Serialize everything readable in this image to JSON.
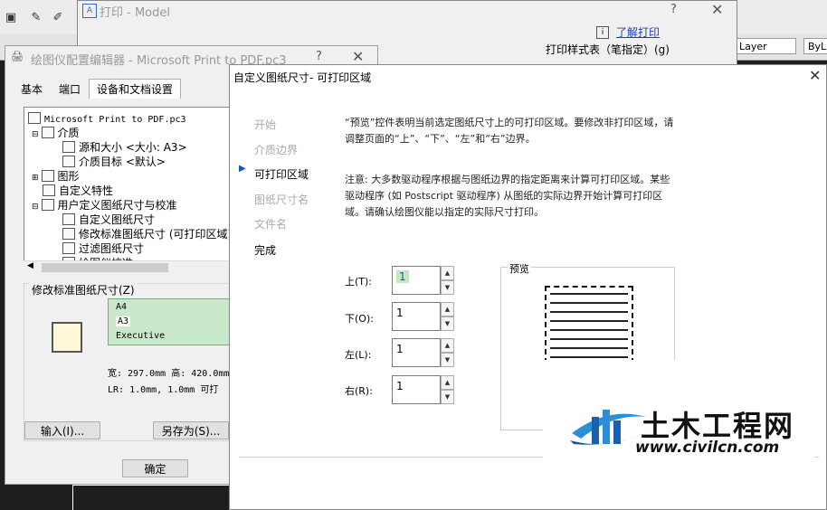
{
  "print_dialog": {
    "title": "打印 - Model",
    "help": "?",
    "learn_link": "了解打印",
    "plot_style_label": "打印样式表（笔指定）(g)"
  },
  "cad": {
    "layer_combo": "Layer",
    "bylayer_combo": "ByL"
  },
  "pc3_dialog": {
    "title": "绘图仪配置编辑器 - Microsoft Print to PDF.pc3",
    "help": "?",
    "tabs": [
      "基本",
      "端口",
      "设备和文档设置"
    ],
    "tree": [
      "Microsoft Print to PDF.pc3",
      "介质",
      "源和大小 <大小: A3>",
      "介质目标 <默认>",
      "图形",
      "自定义特性",
      "用户定义图纸尺寸与校准",
      "自定义图纸尺寸",
      "修改标准图纸尺寸 (可打印区域)",
      "过滤图纸尺寸",
      "绘图仪校准"
    ],
    "modify_group_label": "修改标准图纸尺寸(Z)",
    "papers": [
      "A4",
      "A3",
      "Executive"
    ],
    "size_info": "宽: 297.0mm 高: 420.0mm",
    "margin_info": "LR: 1.0mm, 1.0mm  可打",
    "import_btn": "输入(I)...",
    "saveas_btn": "另存为(S)...",
    "ok_btn": "确定"
  },
  "main_dialog": {
    "title": "自定义图纸尺寸- 可打印区域",
    "nav": [
      {
        "label": "开始",
        "state": "inactive"
      },
      {
        "label": "介质边界",
        "state": "inactive"
      },
      {
        "label": "可打印区域",
        "state": "active"
      },
      {
        "label": "图纸尺寸名",
        "state": "inactive"
      },
      {
        "label": "文件名",
        "state": "inactive"
      },
      {
        "label": "完成",
        "state": "done"
      }
    ],
    "desc1": "“预览”控件表明当前选定图纸尺寸上的可打印区域。要修改非打印区域，请调整页面的“上”、“下”、“左”和“右”边界。",
    "desc2": "注意: 大多数驱动程序根据与图纸边界的指定距离来计算可打印区域。某些驱动程序 (如 Postscript 驱动程序) 从图纸的实际边界开始计算可打印区域。请确认绘图仪能以指定的实际尺寸打印。",
    "fields": [
      {
        "label": "上(T):",
        "value": "1"
      },
      {
        "label": "下(O):",
        "value": "1"
      },
      {
        "label": "左(L):",
        "value": "1"
      },
      {
        "label": "右(R):",
        "value": "1"
      }
    ],
    "preview_label": "预览"
  },
  "watermark": {
    "cn": "土木工程网",
    "url": "www.civilcn.com"
  }
}
